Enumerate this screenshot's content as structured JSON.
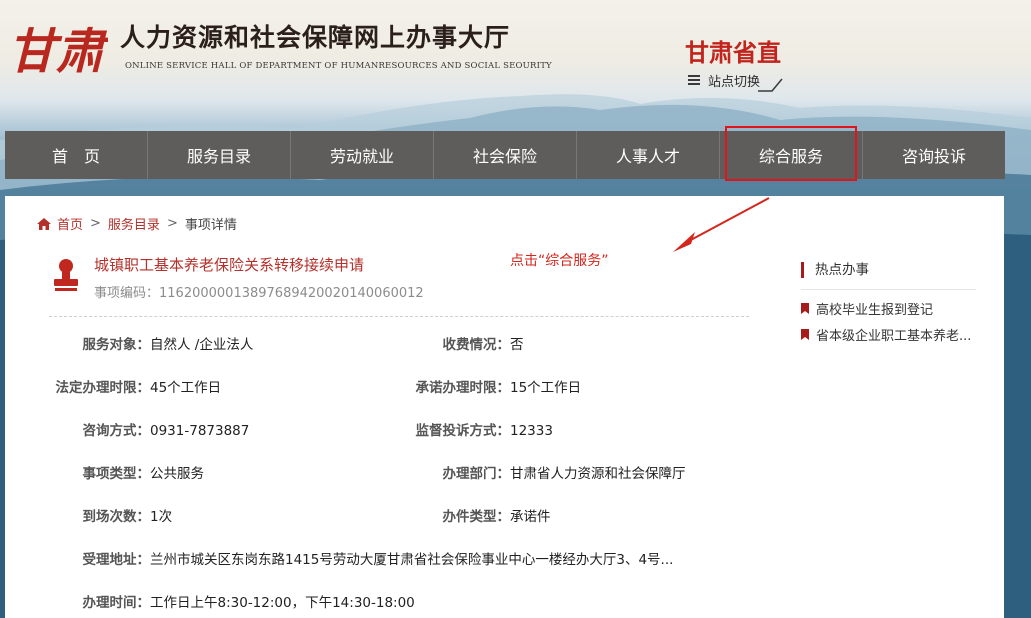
{
  "header": {
    "logo_text": "甘肃",
    "title": "人力资源和社会保障网上办事大厅",
    "subtitle": "ONLINE SERVICE HALL OF DEPARTMENT OF HUMANRESOURCES AND SOCIAL SEOURITY",
    "region": "甘肃省直",
    "switch_label": "站点切换"
  },
  "nav": {
    "items": [
      {
        "label": "首　页"
      },
      {
        "label": "服务目录"
      },
      {
        "label": "劳动就业"
      },
      {
        "label": "社会保险"
      },
      {
        "label": "人事人才"
      },
      {
        "label": "综合服务",
        "active": true
      },
      {
        "label": "咨询投诉"
      }
    ]
  },
  "breadcrumb": {
    "home": "首页",
    "sep": ">",
    "catalog": "服务目录",
    "current": "事项详情"
  },
  "item": {
    "title": "城镇职工基本养老保险关系转移接续申请",
    "code": "事项编码：11620000013897689420020140060012"
  },
  "annotation": "点击“综合服务”",
  "fields": {
    "service_target": {
      "key": "服务对象：",
      "value": "自然人 /企业法人"
    },
    "fee": {
      "key": "收费情况：",
      "value": "否"
    },
    "legal_limit": {
      "key": "法定办理时限：",
      "value": "45个工作日"
    },
    "promise_limit": {
      "key": "承诺办理时限：",
      "value": "15个工作日"
    },
    "consult": {
      "key": "咨询方式：",
      "value": "0931-7873887"
    },
    "complaint": {
      "key": "监督投诉方式：",
      "value": "12333"
    },
    "type": {
      "key": "事项类型：",
      "value": "公共服务"
    },
    "department": {
      "key": "办理部门：",
      "value": "甘肃省人力资源和社会保障厅"
    },
    "visits": {
      "key": "到场次数：",
      "value": "1次"
    },
    "doc_type": {
      "key": "办件类型：",
      "value": "承诺件"
    },
    "address": {
      "key": "受理地址：",
      "value": "兰州市城关区东岗东路1415号劳动大厦甘肃省社会保险事业中心一楼经办大厅3、4号..."
    },
    "hours": {
      "key": "办理时间：",
      "value": "工作日上午8:30-12:00，下午14:30-18:00"
    }
  },
  "sidebar": {
    "title": "热点办事",
    "items": [
      {
        "label": "高校毕业生报到登记"
      },
      {
        "label": "省本级企业职工基本养老..."
      }
    ]
  },
  "colors": {
    "accent_red": "#b4302a",
    "nav_bg": "#5e5d5c",
    "highlight_box": "#e0141b"
  }
}
